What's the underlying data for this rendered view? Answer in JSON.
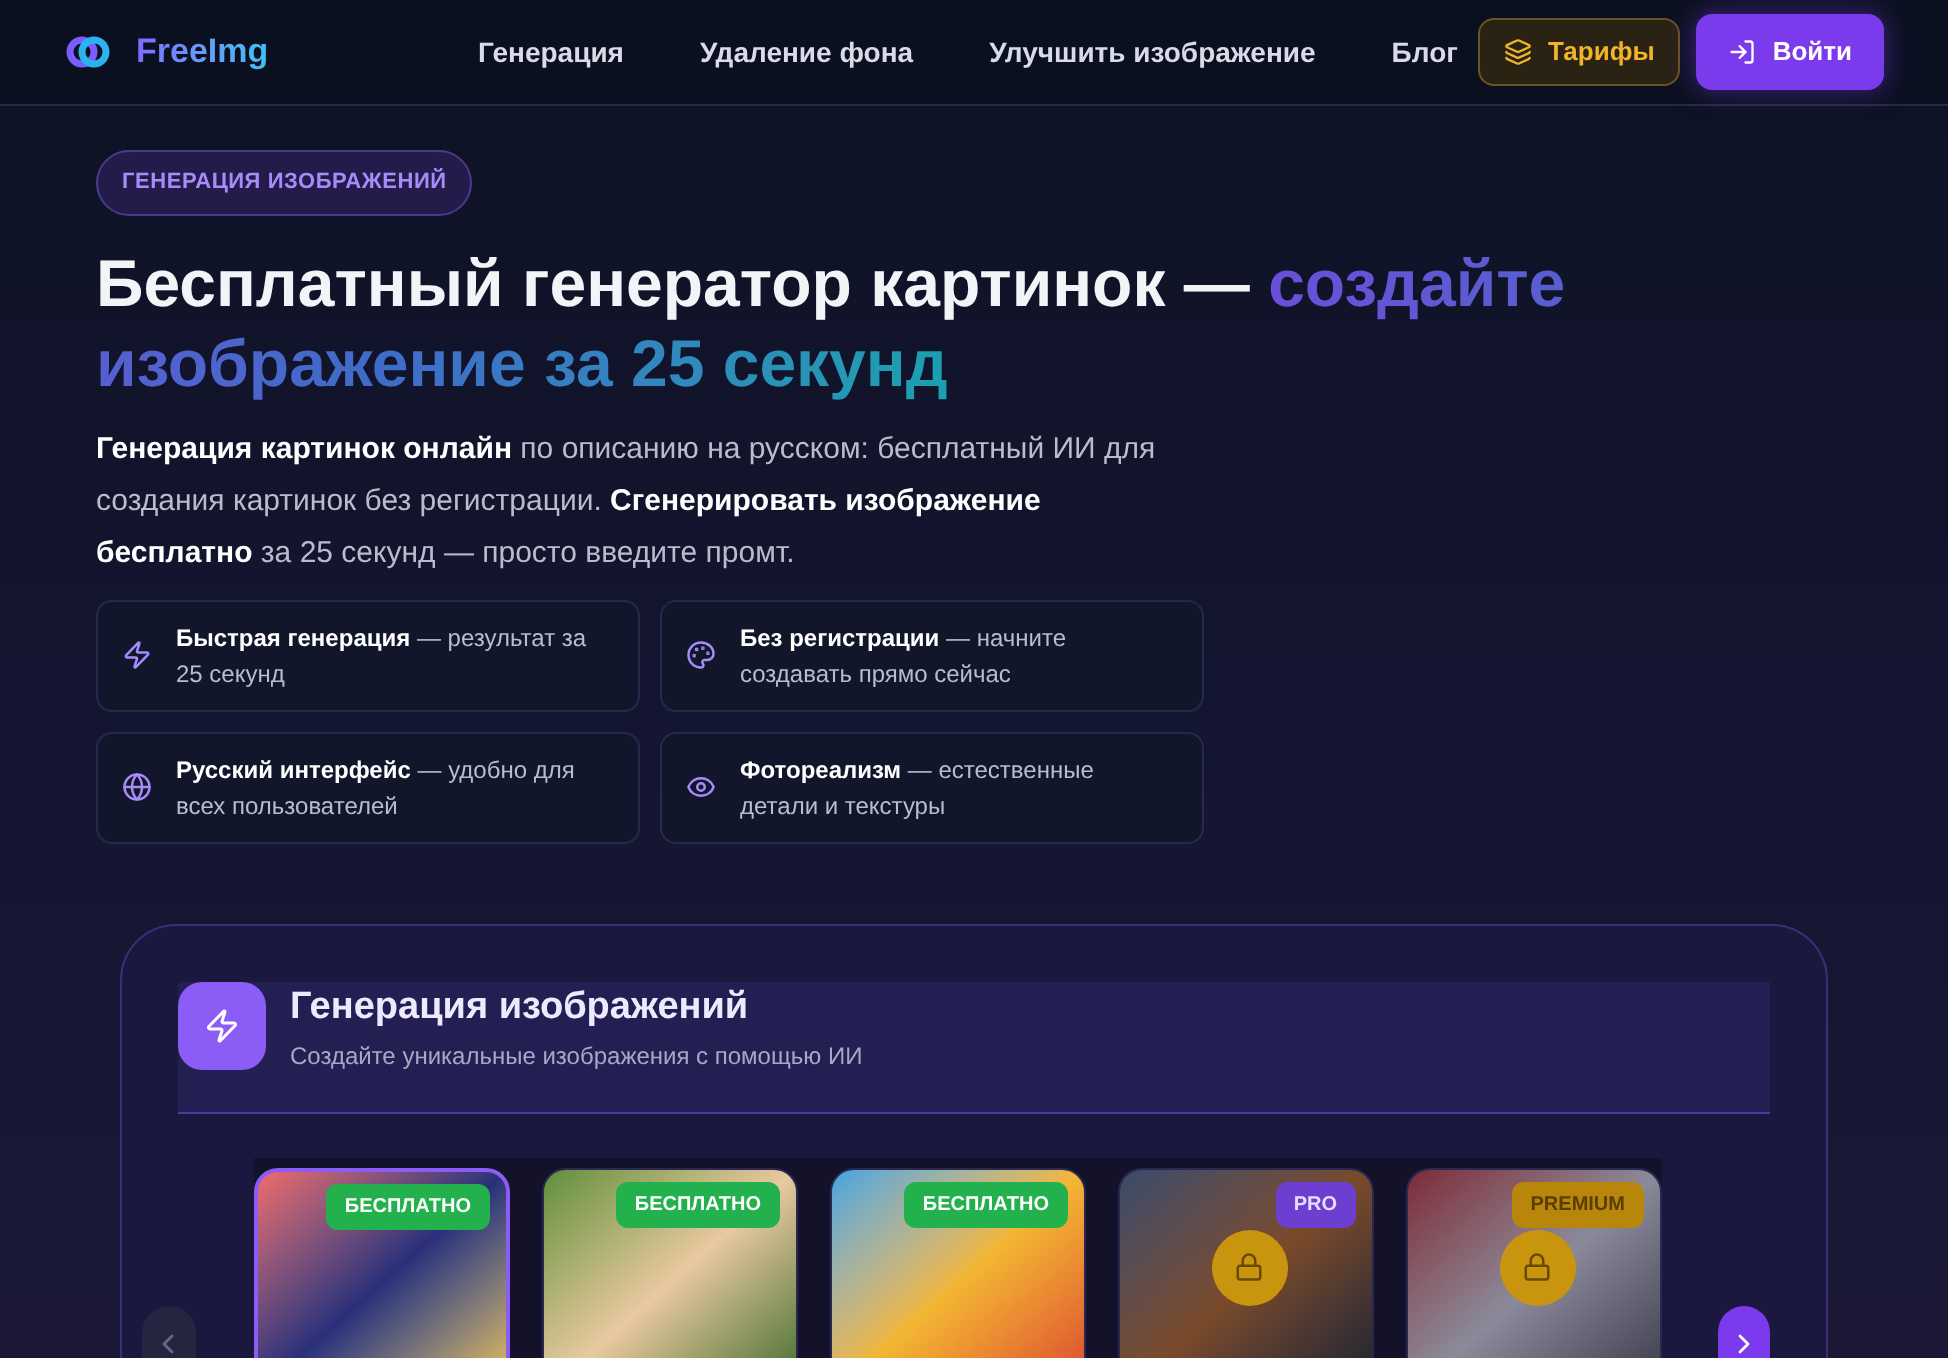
{
  "header": {
    "logo": "FreeImg",
    "nav": [
      "Генерация",
      "Удаление фона",
      "Улучшить изображение",
      "Блог"
    ],
    "pricing_button": "Тарифы",
    "login_button": "Войти"
  },
  "hero": {
    "eyebrow": "ГЕНЕРАЦИЯ ИЗОБРАЖЕНИЙ",
    "title": "Бесплатный генератор картинок — ",
    "title_highlight": "создайте изображение за 25 секунд",
    "description": "**Генерация картинок онлайн** по описанию на русском: бесплатный ИИ для создания картинок без регистрации. **Сгенерировать изображение бесплатно** за 25 секунд — просто введите промт.",
    "features": [
      {
        "text": "**Быстрая генерация** — результат за 25 секунд"
      },
      {
        "text": "**Без регистрации** — начните создавать прямо сейчас"
      },
      {
        "text": "**Русский интерфейс** — удобно для всех пользователей"
      },
      {
        "text": "**Фотореализм** — естественные детали и текстуры"
      }
    ]
  },
  "generator": {
    "title": "Генерация изображений",
    "subtitle": "Создайте уникальные изображения с помощью ИИ",
    "models": [
      {
        "badge": "БЕСПЛАТНО",
        "kind": "free",
        "locked": false,
        "selected": true
      },
      {
        "badge": "БЕСПЛАТНО",
        "kind": "free",
        "locked": false,
        "selected": false
      },
      {
        "badge": "БЕСПЛАТНО",
        "kind": "free",
        "locked": false,
        "selected": false
      },
      {
        "badge": "PRO",
        "kind": "pro",
        "locked": true,
        "selected": false
      },
      {
        "badge": "PREMIUM",
        "kind": "premium",
        "locked": true,
        "selected": false
      }
    ]
  }
}
